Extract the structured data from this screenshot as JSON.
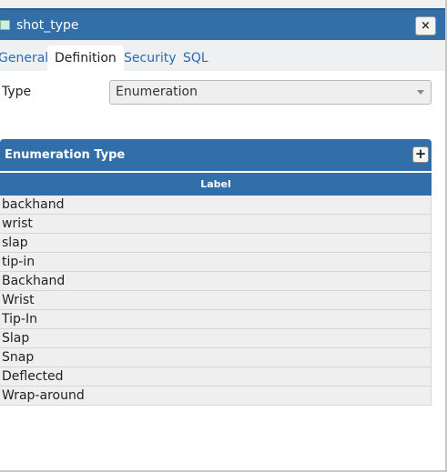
{
  "dialog": {
    "title": "shot_type",
    "close_glyph": "×"
  },
  "tabs": [
    {
      "label": "General",
      "active": false
    },
    {
      "label": "Definition",
      "active": true
    },
    {
      "label": "Security",
      "active": false
    },
    {
      "label": "SQL",
      "active": false
    }
  ],
  "form": {
    "type_label": "Type",
    "type_value": "Enumeration"
  },
  "panel": {
    "title": "Enumeration Type",
    "add_glyph": "+",
    "column_header": "Label",
    "rows": [
      "backhand",
      "wrist",
      "slap",
      "tip-in",
      "Backhand",
      "Wrist",
      "Tip-In",
      "Slap",
      "Snap",
      "Deflected",
      "Wrap-around"
    ]
  },
  "colors": {
    "header_blue": "#326ea8",
    "tab_link": "#2a6db0",
    "row_bg": "#efefef"
  }
}
